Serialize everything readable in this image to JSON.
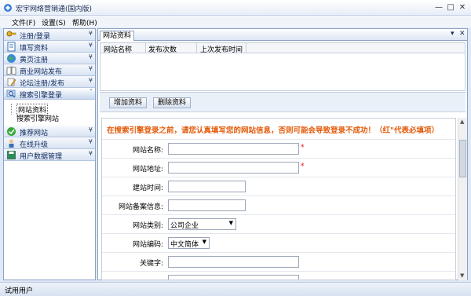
{
  "window": {
    "title": "宏宇网络营销通(国内版)",
    "controls": [
      "—",
      "□",
      "✕"
    ]
  },
  "menu": [
    {
      "label": "文件(F)"
    },
    {
      "label": "设置(S)"
    },
    {
      "label": "帮助(H)"
    }
  ],
  "sidebar": {
    "items": [
      {
        "label": "注册/登录",
        "icon": "key-icon",
        "chevron": "¥"
      },
      {
        "label": "填写资料",
        "icon": "notebook-icon",
        "chevron": "¥"
      },
      {
        "label": "黄页注册",
        "icon": "globe-icon",
        "chevron": "¥"
      },
      {
        "label": "商业网站发布",
        "icon": "book-icon",
        "chevron": "¥"
      },
      {
        "label": "论坛注册/发布",
        "icon": "pencil-icon",
        "chevron": "¥"
      },
      {
        "label": "搜索引擎登录",
        "icon": "search-icon",
        "chevron": "ˆ"
      },
      {
        "label": "推荐网站",
        "icon": "checkmark-icon",
        "chevron": "¥"
      },
      {
        "label": "在线升级",
        "icon": "person-icon",
        "chevron": "¥"
      },
      {
        "label": "用户数据管理",
        "icon": "save-icon",
        "chevron": "¥"
      }
    ],
    "sub_items": [
      {
        "label": "网站资料"
      },
      {
        "label": "搜索引擎网站"
      }
    ]
  },
  "main": {
    "tab": "网站资料",
    "tab_controls": [
      "▾",
      "✕"
    ],
    "grid_columns": [
      "网站名称",
      "发布次数",
      "上次发布时间"
    ],
    "toolbar": {
      "add_label": "增加资料",
      "delete_label": "删除资料"
    },
    "notice": "在搜索引擎登录之前，请您认真填写您的网站信息，否则可能会导致登录不成功！（红\"代表必填项）",
    "form": {
      "site_name": {
        "label": "网站名称:",
        "value": "",
        "required_mark": "*"
      },
      "site_url": {
        "label": "网站地址:",
        "value": "",
        "required_mark": "*"
      },
      "build_date": {
        "label": "建站时间:",
        "value": ""
      },
      "icp": {
        "label": "网站备案信息:",
        "value": ""
      },
      "category": {
        "label": "网站类别:",
        "value": "公司企业"
      },
      "encoding": {
        "label": "网站编码:",
        "value": "中文简体"
      },
      "keywords": {
        "label": "关键字:",
        "value": ""
      }
    }
  },
  "status": {
    "text": "试用用户"
  },
  "colors": {
    "notice": "#e35a0a",
    "required": "#ee0000",
    "frame": "#8da2c4"
  }
}
